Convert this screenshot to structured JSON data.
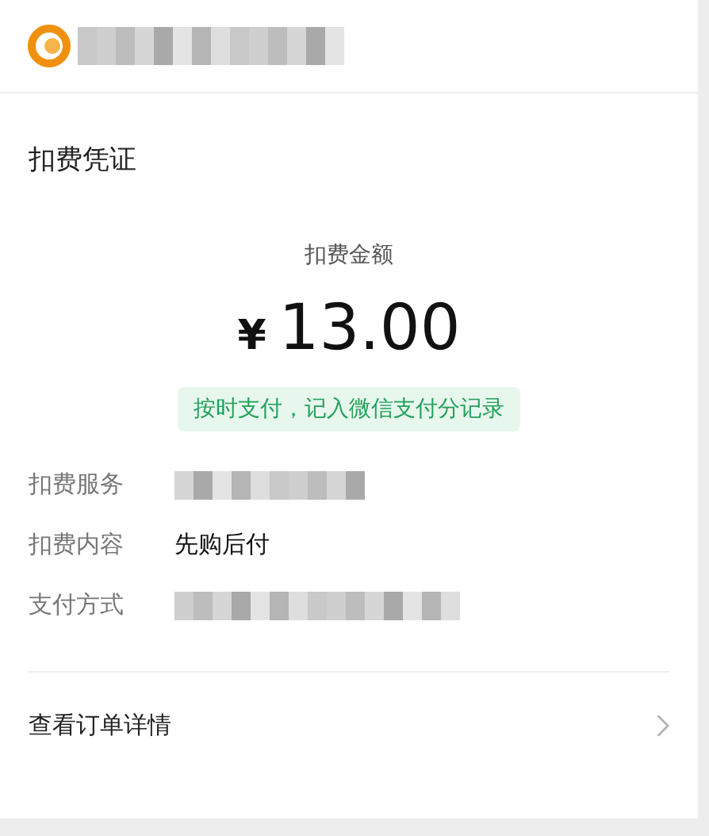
{
  "header": {
    "name_redacted": true
  },
  "card": {
    "title": "扣费凭证",
    "amount_label": "扣费金额",
    "currency": "¥",
    "amount": "13.00",
    "badge": "按时支付，记入微信支付分记录",
    "rows": [
      {
        "label": "扣费服务",
        "kind": "redacted"
      },
      {
        "label": "扣费内容",
        "kind": "text",
        "value": "先购后付"
      },
      {
        "label": "支付方式",
        "kind": "redacted"
      }
    ],
    "link": "查看订单详情"
  }
}
